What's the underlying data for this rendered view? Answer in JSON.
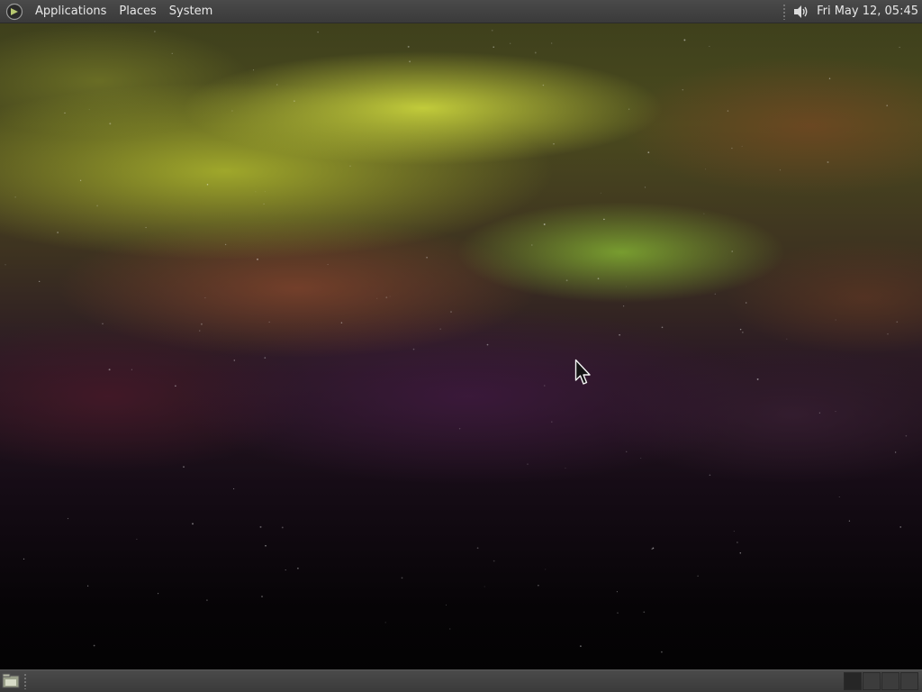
{
  "top_panel": {
    "menus": [
      {
        "label": "Applications"
      },
      {
        "label": "Places"
      },
      {
        "label": "System"
      }
    ],
    "menu_icon": "mint-logo-icon",
    "volume_icon": "speaker-volume-icon",
    "clock": "Fri May 12, 05:45"
  },
  "bottom_panel": {
    "show_desktop_icon": "show-desktop-icon",
    "workspaces": [
      {
        "active": true
      },
      {
        "active": false
      },
      {
        "active": false
      },
      {
        "active": false
      }
    ]
  },
  "desktop": {
    "wallpaper": "aurora",
    "pointer_icon": "mouse-pointer-icon"
  },
  "colors": {
    "panel": "#3f3f3f",
    "panel_text": "#e8e8e8"
  }
}
